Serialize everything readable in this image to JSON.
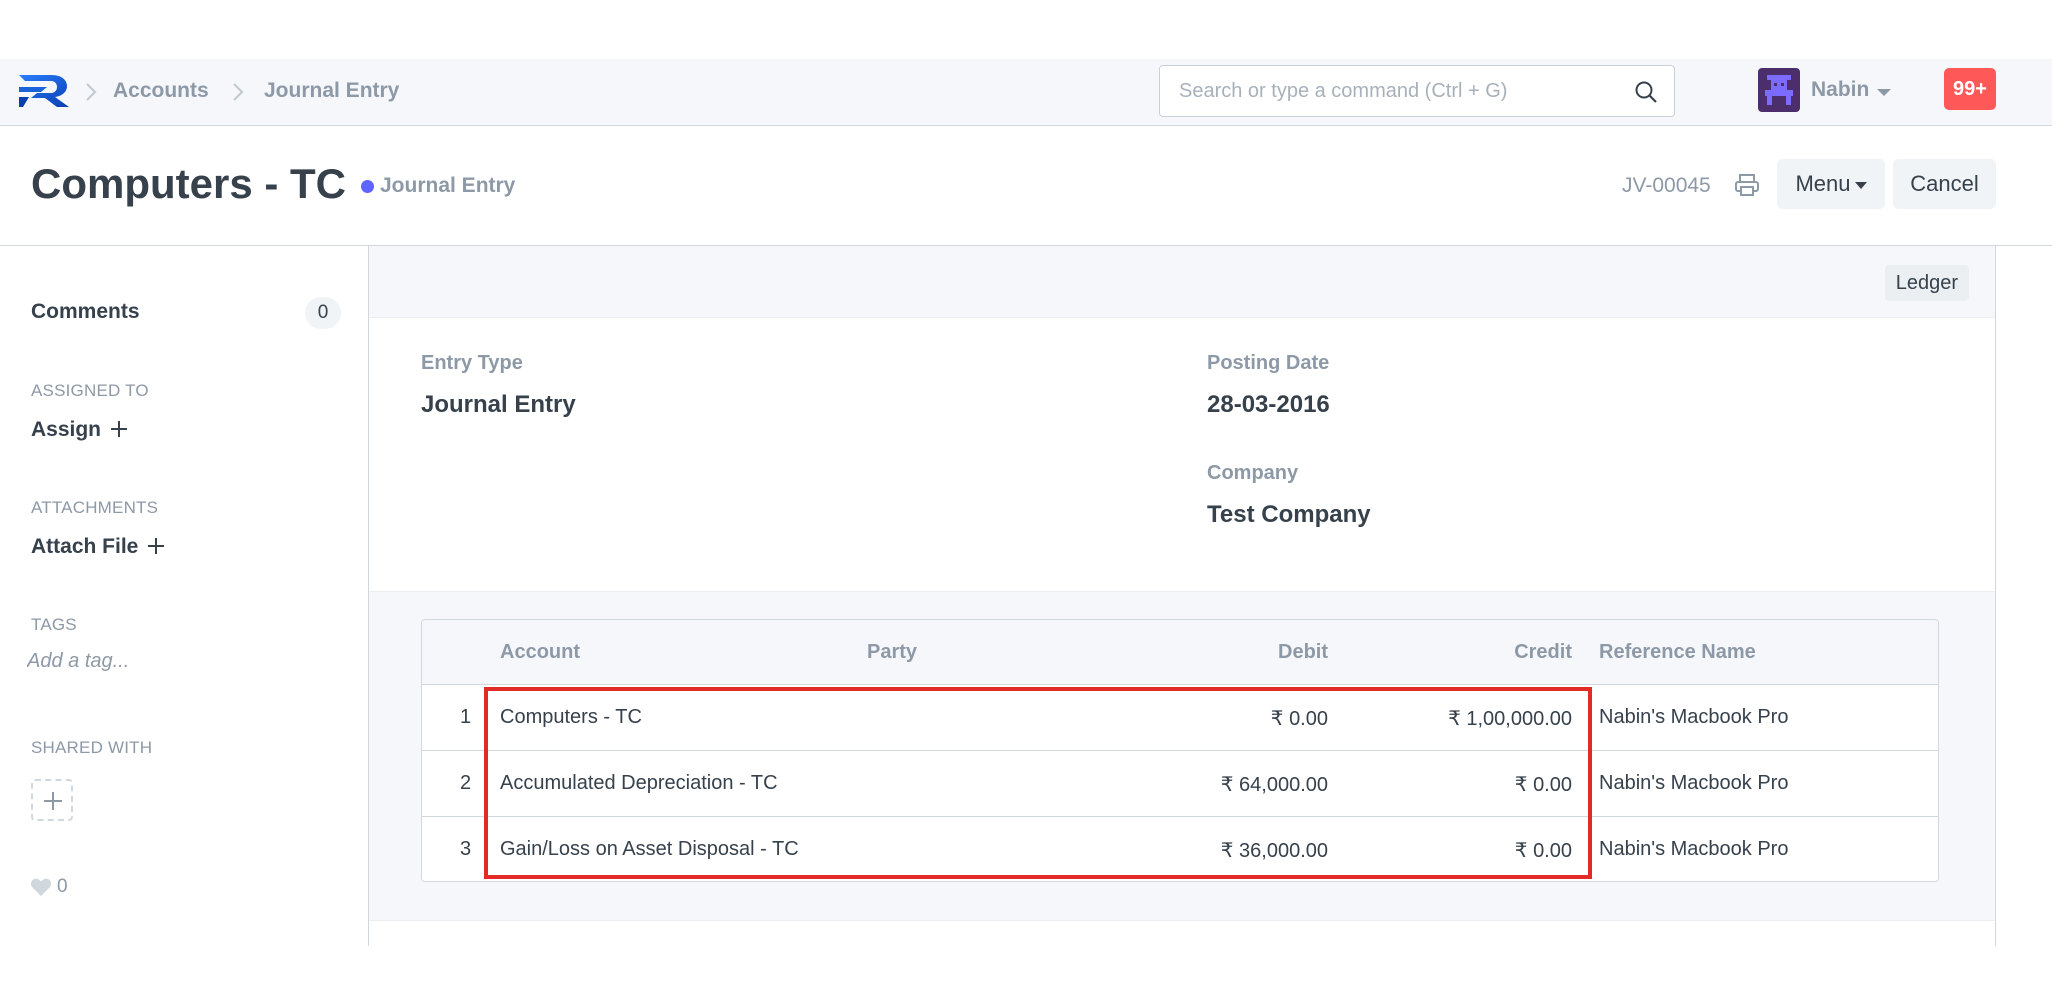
{
  "navbar": {
    "breadcrumbs": [
      "Accounts",
      "Journal Entry"
    ],
    "search_placeholder": "Search or type a command (Ctrl + G)",
    "user_name": "Nabin",
    "notification_count": "99+"
  },
  "header": {
    "title": "Computers - TC",
    "indicator": "Journal Entry",
    "indicator_color": "#5e64ff",
    "doc_name": "JV-00045",
    "menu_label": "Menu",
    "cancel_label": "Cancel"
  },
  "sidebar": {
    "comments_label": "Comments",
    "comments_count": "0",
    "assigned_to_label": "ASSIGNED TO",
    "assign_label": "Assign",
    "attachments_label": "ATTACHMENTS",
    "attach_label": "Attach File",
    "tags_label": "TAGS",
    "tag_placeholder": "Add a tag...",
    "shared_with_label": "SHARED WITH",
    "likes_count": "0"
  },
  "form": {
    "ledger_label": "Ledger",
    "entry_type_label": "Entry Type",
    "entry_type_value": "Journal Entry",
    "posting_date_label": "Posting Date",
    "posting_date_value": "28-03-2016",
    "company_label": "Company",
    "company_value": "Test Company"
  },
  "accounts_table": {
    "columns": [
      "Account",
      "Party",
      "Debit",
      "Credit",
      "Reference Name"
    ],
    "rows": [
      {
        "idx": "1",
        "account": "Computers - TC",
        "party": "",
        "debit": "₹ 0.00",
        "credit": "₹ 1,00,000.00",
        "reference_name": "Nabin's Macbook Pro"
      },
      {
        "idx": "2",
        "account": "Accumulated Depreciation - TC",
        "party": "",
        "debit": "₹ 64,000.00",
        "credit": "₹ 0.00",
        "reference_name": "Nabin's Macbook Pro"
      },
      {
        "idx": "3",
        "account": "Gain/Loss on Asset Disposal - TC",
        "party": "",
        "debit": "₹ 36,000.00",
        "credit": "₹ 0.00",
        "reference_name": "Nabin's Macbook Pro"
      }
    ]
  },
  "colors": {
    "highlight_border": "#e22b26",
    "notification_badge": "#ff5858"
  }
}
